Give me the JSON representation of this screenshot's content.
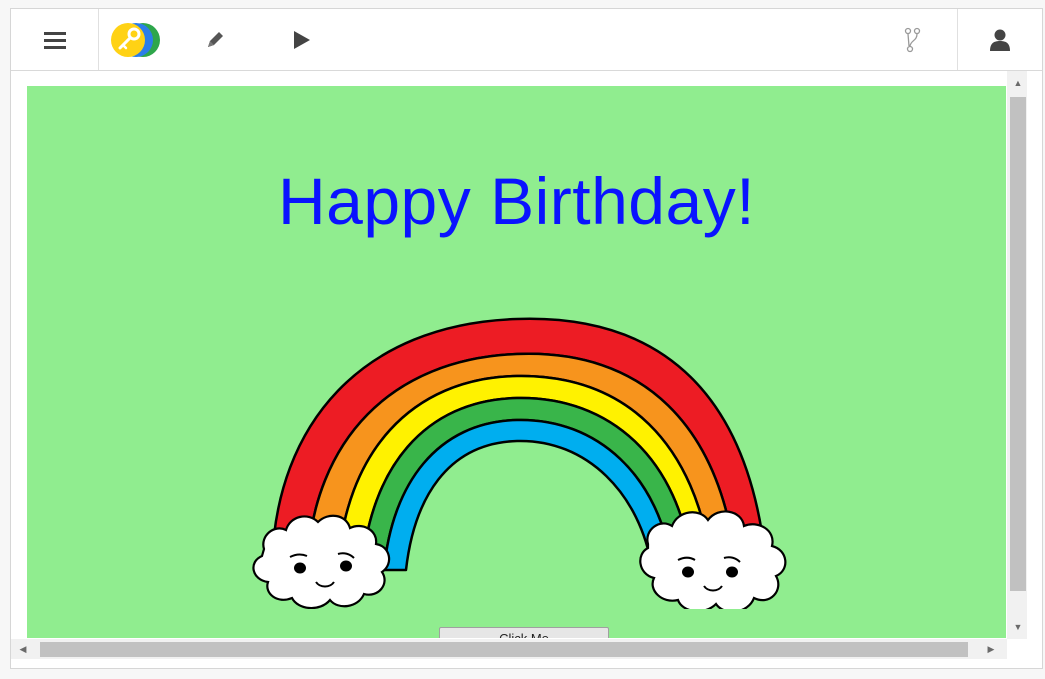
{
  "toolbar": {
    "menu_icon": "hamburger-menu-icon",
    "logo_icon": "key-logo-icon",
    "edit_icon": "pencil-icon",
    "run_icon": "play-icon",
    "fork_icon": "fork-icon",
    "user_icon": "user-icon"
  },
  "card": {
    "title": "Happy Birthday!",
    "title_color": "#0a13ff",
    "background": "#90ed8f",
    "button_label": "Click Me"
  },
  "colors": {
    "rainbow": [
      "#ed1c24",
      "#f7941d",
      "#fff200",
      "#39b54a",
      "#00aeef"
    ],
    "cloud": "#ffffff"
  }
}
